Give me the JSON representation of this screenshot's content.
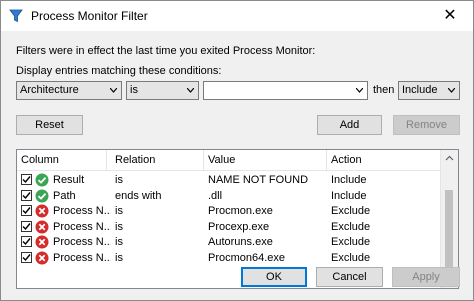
{
  "window": {
    "title": "Process Monitor Filter",
    "close_glyph": "✕"
  },
  "info_text": "Filters were in effect the last time you exited Process Monitor:",
  "conditions_label": "Display entries matching these conditions:",
  "filter_row": {
    "column_value": "Architecture",
    "relation_value": "is",
    "value_value": "",
    "then_label": "then",
    "action_value": "Include"
  },
  "buttons": {
    "reset": "Reset",
    "add": "Add",
    "remove": "Remove",
    "ok": "OK",
    "cancel": "Cancel",
    "apply": "Apply"
  },
  "list": {
    "headers": {
      "column": "Column",
      "relation": "Relation",
      "value": "Value",
      "action": "Action"
    },
    "rows": [
      {
        "checked": true,
        "status": "include-check-icon",
        "column": "Result",
        "relation": "is",
        "value": "NAME NOT FOUND",
        "action": "Include"
      },
      {
        "checked": true,
        "status": "include-check-icon",
        "column": "Path",
        "relation": "ends with",
        "value": ".dll",
        "action": "Include"
      },
      {
        "checked": true,
        "status": "exclude-x-icon",
        "column": "Process N...",
        "relation": "is",
        "value": "Procmon.exe",
        "action": "Exclude"
      },
      {
        "checked": true,
        "status": "exclude-x-icon",
        "column": "Process N...",
        "relation": "is",
        "value": "Procexp.exe",
        "action": "Exclude"
      },
      {
        "checked": true,
        "status": "exclude-x-icon",
        "column": "Process N...",
        "relation": "is",
        "value": "Autoruns.exe",
        "action": "Exclude"
      },
      {
        "checked": true,
        "status": "exclude-x-icon",
        "column": "Process N...",
        "relation": "is",
        "value": "Procmon64.exe",
        "action": "Exclude"
      }
    ]
  },
  "colors": {
    "include_green": "#3aa655",
    "exclude_red": "#d42b2b",
    "default_button_border": "#0078d7"
  }
}
